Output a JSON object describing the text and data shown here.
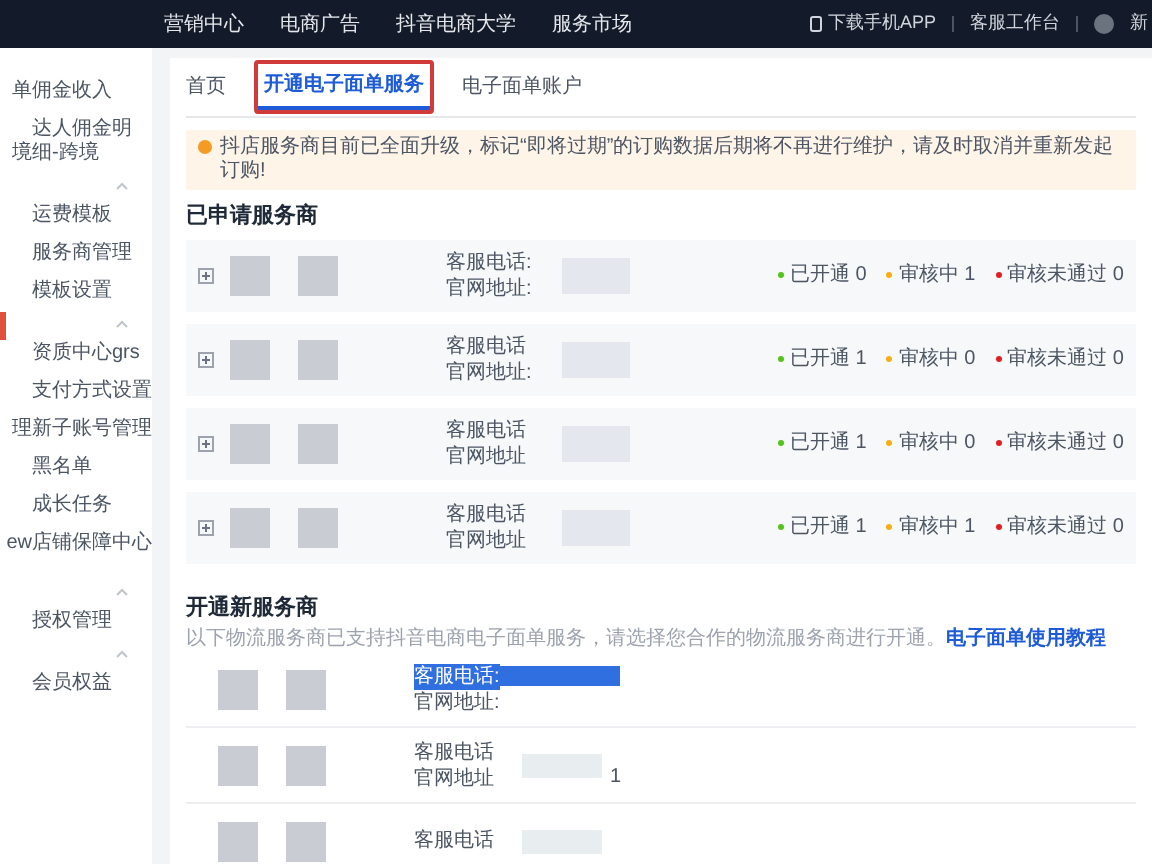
{
  "top_nav": {
    "items": [
      "营销中心",
      "电商广告",
      "抖音电商大学",
      "服务市场"
    ],
    "right": [
      {
        "kind": "phone",
        "label": "下载手机APP"
      },
      {
        "kind": "plain",
        "label": "客服工作台"
      },
      {
        "kind": "user",
        "label": "新"
      }
    ]
  },
  "sidebar": {
    "groups": [
      {
        "chevron": false,
        "edge_marker": false,
        "items": [
          {
            "label": "佣金收入",
            "edge": "单"
          },
          {
            "label": "达人佣金明细-跨境",
            "edge": "境"
          }
        ]
      },
      {
        "chevron": true,
        "edge_marker": true,
        "items": [
          {
            "label": "运费模板"
          },
          {
            "label": "服务商管理"
          },
          {
            "label": "模板设置"
          }
        ]
      },
      {
        "chevron": true,
        "edge_marker": false,
        "items": [
          {
            "label": "资质中心grs"
          },
          {
            "label": "支付方式设置"
          },
          {
            "label": "新子账号管理",
            "edge": "理"
          },
          {
            "label": "黑名单"
          },
          {
            "label": "成长任务"
          },
          {
            "label": "店铺保障中心",
            "edge": "ew"
          }
        ]
      },
      {
        "chevron": true,
        "edge_marker": false,
        "items": [
          {
            "label": "授权管理"
          }
        ]
      },
      {
        "chevron": true,
        "edge_marker": false,
        "items": [
          {
            "label": "会员权益"
          }
        ]
      }
    ]
  },
  "tabs": [
    {
      "label": "首页",
      "selected": false
    },
    {
      "label": "开通电子面单服务",
      "selected": true
    },
    {
      "label": "电子面单账户",
      "selected": false
    }
  ],
  "alert": "抖店服务商目前已全面升级，标记“即将过期”的订购数据后期将不再进行维护，请及时取消并重新发起订购!",
  "applied": {
    "title": "已申请服务商",
    "rows": [
      {
        "phone_label": "客服电话:",
        "site_label": "官网地址:",
        "statuses": [
          {
            "label": "已开通 0",
            "color": "#52c41a"
          },
          {
            "label": "审核中 1",
            "color": "#faad14"
          },
          {
            "label": "审核未通过 0",
            "color": "#e02020"
          }
        ]
      },
      {
        "phone_label": "客服电话",
        "site_label": "官网地址:",
        "statuses": [
          {
            "label": "已开通 1",
            "color": "#52c41a"
          },
          {
            "label": "审核中 0",
            "color": "#faad14"
          },
          {
            "label": "审核未通过 0",
            "color": "#e02020"
          }
        ]
      },
      {
        "phone_label": "客服电话",
        "site_label": "官网地址",
        "statuses": [
          {
            "label": "已开通 1",
            "color": "#52c41a"
          },
          {
            "label": "审核中 0",
            "color": "#faad14"
          },
          {
            "label": "审核未通过 0",
            "color": "#e02020"
          }
        ]
      },
      {
        "phone_label": "客服电话",
        "site_label": "官网地址",
        "statuses": [
          {
            "label": "已开通 1",
            "color": "#52c41a"
          },
          {
            "label": "审核中 1",
            "color": "#faad14"
          },
          {
            "label": "审核未通过 0",
            "color": "#e02020"
          }
        ]
      }
    ]
  },
  "new_providers": {
    "title": "开通新服务商",
    "description": "以下物流服务商已支持抖音电商电子面单服务，请选择您合作的物流服务商进行开通。",
    "link": "电子面单使用教程",
    "rows": [
      {
        "phone_label": "客服电话:",
        "phone_highlighted": true,
        "site_label": "官网地址:"
      },
      {
        "phone_label": "客服电话",
        "phone_highlighted": false,
        "site_label": "官网地址",
        "site_value": "1"
      },
      {
        "phone_label": "客服电话",
        "phone_highlighted": false
      }
    ]
  }
}
